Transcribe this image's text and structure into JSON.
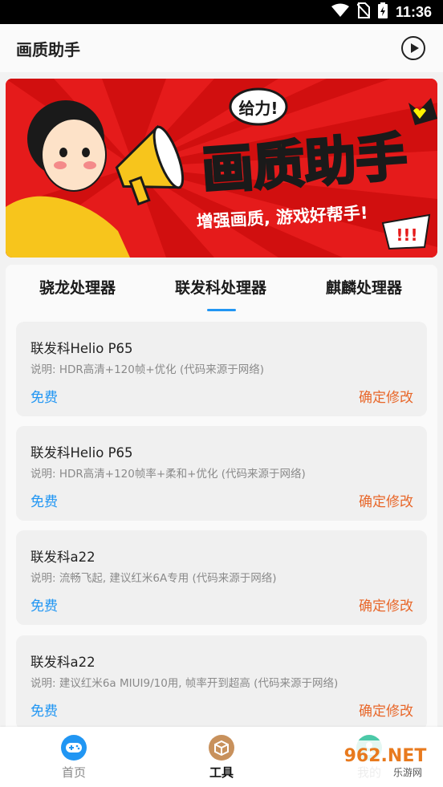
{
  "status_bar": {
    "time": "11:36"
  },
  "app_bar": {
    "title": "画质助手"
  },
  "banner": {
    "bubble_text": "给力!",
    "headline": "画质助手",
    "slogan": "增强画质, 游戏好帮手!",
    "exclaim": "!!!"
  },
  "tabs": [
    {
      "label": "骁龙处理器"
    },
    {
      "label": "联发科处理器"
    },
    {
      "label": "麒麟处理器"
    }
  ],
  "items": [
    {
      "title": "联发科Helio P65",
      "desc": "说明: HDR高清+120帧+优化 (代码来源于网络)",
      "price": "免费",
      "action": "确定修改"
    },
    {
      "title": "联发科Helio P65",
      "desc": "说明: HDR高清+120帧率+柔和+优化 (代码来源于网络)",
      "price": "免费",
      "action": "确定修改"
    },
    {
      "title": "联发科a22",
      "desc": "说明: 流畅飞起, 建议红米6A专用 (代码来源于网络)",
      "price": "免费",
      "action": "确定修改"
    },
    {
      "title": "联发科a22",
      "desc": "说明: 建议红米6a MIUI9/10用, 帧率开到超高 (代码来源于网络)",
      "price": "免费",
      "action": "确定修改"
    }
  ],
  "bottom_nav": [
    {
      "label": "首页",
      "icon": "gamepad-icon"
    },
    {
      "label": "工具",
      "icon": "box-icon"
    },
    {
      "label": "我的",
      "icon": "user-icon"
    }
  ],
  "watermark": {
    "text": "962.NET",
    "sub": "乐游网"
  },
  "colors": {
    "accent": "#2196f3",
    "action": "#e8672a",
    "banner_red": "#e51b1b",
    "banner_yellow": "#fff200"
  }
}
